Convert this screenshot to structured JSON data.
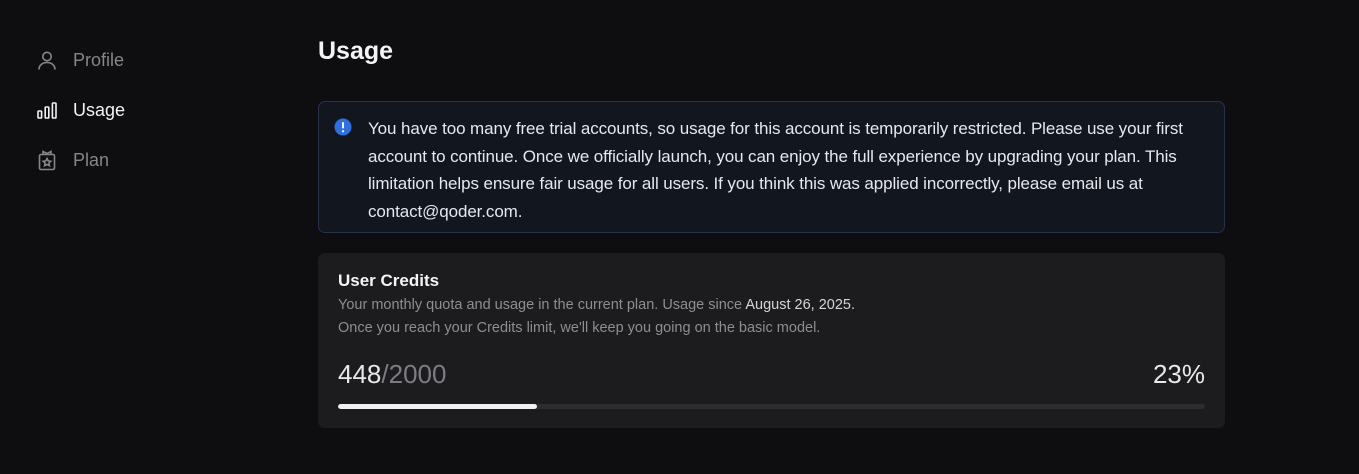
{
  "sidebar": {
    "items": [
      {
        "label": "Profile",
        "icon": "user-icon",
        "active": false
      },
      {
        "label": "Usage",
        "icon": "bar-chart-icon",
        "active": true
      },
      {
        "label": "Plan",
        "icon": "plan-badge-icon",
        "active": false
      }
    ]
  },
  "main": {
    "title": "Usage",
    "notice": {
      "icon": "info-icon",
      "text": "You have too many free trial accounts, so usage for this account is temporarily restricted. Please use your first account to continue. Once we officially launch, you can enjoy the full experience by upgrading your plan. This limitation helps ensure fair usage for all users. If you think this was applied incorrectly, please email us at contact@qoder.com."
    },
    "credits": {
      "title": "User Credits",
      "desc_line1": "Your monthly quota and usage in the current plan. Usage since ",
      "since_date": "August 26, 2025.",
      "desc_line2": "Once you reach your Credits limit, we'll keep you going on the basic model.",
      "used": "448",
      "separator": "/",
      "limit": "2000",
      "percent": "23%",
      "progress_fraction": 0.23
    }
  },
  "colors": {
    "background": "#0e0e10",
    "notice_bg": "#12161f",
    "notice_border": "#26324a",
    "info_blue": "#2f6fe0",
    "card_bg": "#1c1c1f",
    "progress_fill": "#f0f0f2",
    "progress_track": "#2c2c30"
  }
}
